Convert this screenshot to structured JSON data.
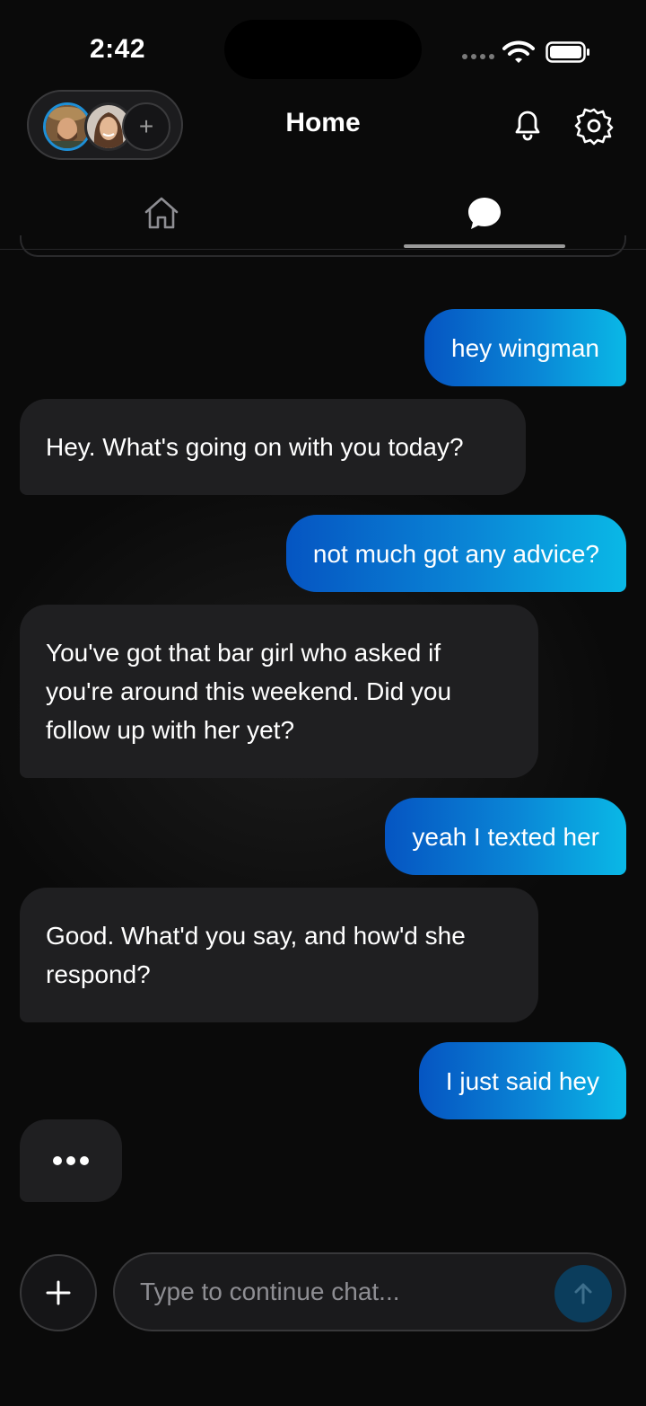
{
  "status_bar": {
    "time": "2:42",
    "icons": [
      "signal-dots",
      "wifi-icon",
      "battery-icon"
    ]
  },
  "header": {
    "title": "Home",
    "add_avatar_label": "+",
    "avatars": [
      "profile-avatar-man",
      "profile-avatar-woman"
    ],
    "icons": [
      "bell-icon",
      "gear-icon"
    ]
  },
  "tabs": [
    {
      "name": "home",
      "icon": "house-icon",
      "active": false
    },
    {
      "name": "chat",
      "icon": "chat-bubble-icon",
      "active": true
    }
  ],
  "messages": [
    {
      "sender": "user",
      "text": "hey wingman"
    },
    {
      "sender": "bot",
      "text": "Hey. What's going on with you today?"
    },
    {
      "sender": "user",
      "text": "not much got any advice?"
    },
    {
      "sender": "bot",
      "lines": [
        "You've got that bar girl who asked if",
        "you're around this weekend. Did you",
        "follow up with her yet?"
      ]
    },
    {
      "sender": "user",
      "text": "yeah I texted her"
    },
    {
      "sender": "bot",
      "lines": [
        "Good. What'd you say, and how'd she",
        "respond?"
      ]
    },
    {
      "sender": "user",
      "text": "I just said hey"
    }
  ],
  "typing_indicator": true,
  "composer": {
    "placeholder": "Type to continue chat...",
    "value": ""
  },
  "colors": {
    "background": "#0a0a0a",
    "user_bubble_start": "#0555c2",
    "user_bubble_end": "#0ab8e6",
    "bot_bubble": "#1f1f21",
    "send_button": "#0b3d5c"
  }
}
